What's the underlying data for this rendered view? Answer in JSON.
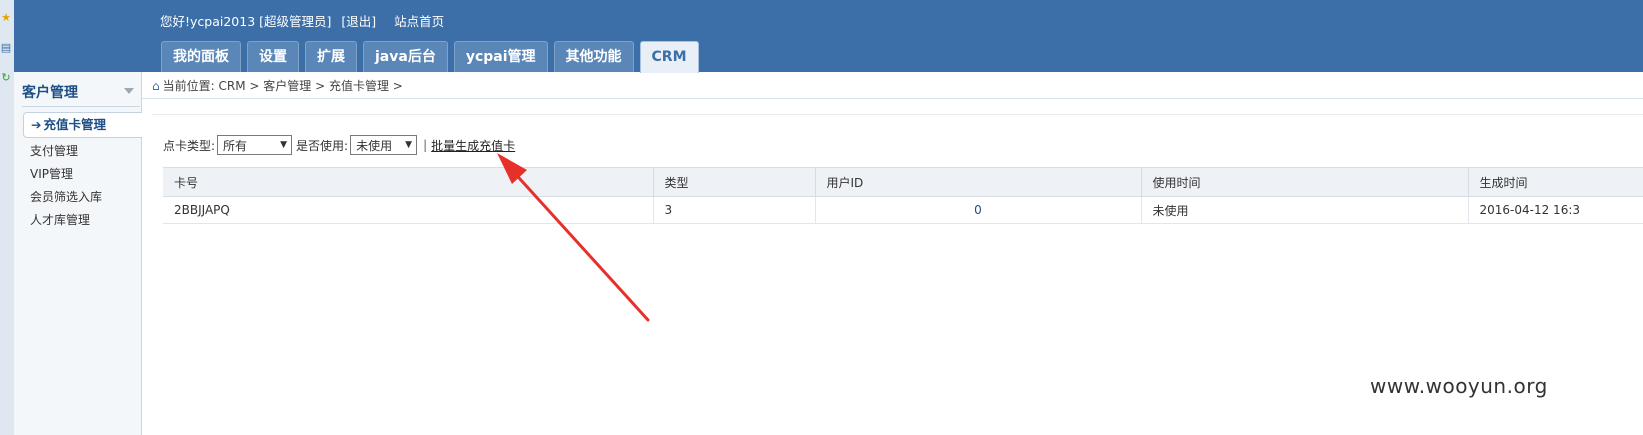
{
  "header": {
    "greeting": "您好!",
    "username": "ycpai2013",
    "role": "[超级管理员]",
    "logout": "[退出]",
    "home_link": "站点首页",
    "tabs": [
      {
        "label": "我的面板"
      },
      {
        "label": "设置"
      },
      {
        "label": "扩展"
      },
      {
        "label": "java后台"
      },
      {
        "label": "ycpai管理"
      },
      {
        "label": "其他功能"
      },
      {
        "label": "CRM",
        "active": true
      }
    ]
  },
  "sidebar": {
    "title": "客户管理",
    "items": [
      {
        "label": "充值卡管理",
        "active": true
      },
      {
        "label": "支付管理"
      },
      {
        "label": "VIP管理"
      },
      {
        "label": "会员筛选入库"
      },
      {
        "label": "人才库管理"
      }
    ]
  },
  "breadcrumb": {
    "prefix": "当前位置:",
    "path": "CRM > 客户管理 > 充值卡管理 >"
  },
  "filter": {
    "card_type_label": "点卡类型:",
    "card_type_value": "所有",
    "used_label": "是否使用:",
    "used_value": "未使用",
    "separator": "|",
    "batch_link": "批量生成充值卡"
  },
  "table": {
    "columns": [
      "卡号",
      "类型",
      "用户ID",
      "使用时间",
      "生成时间"
    ],
    "rows": [
      [
        "2BBJJAPQ",
        "3",
        "0",
        "未使用",
        "2016-04-12 16:3"
      ]
    ]
  },
  "watermark": "www.wooyun.org",
  "colors": {
    "header_bg": "#3c6fa8",
    "annotation_arrow": "#e8302a"
  }
}
